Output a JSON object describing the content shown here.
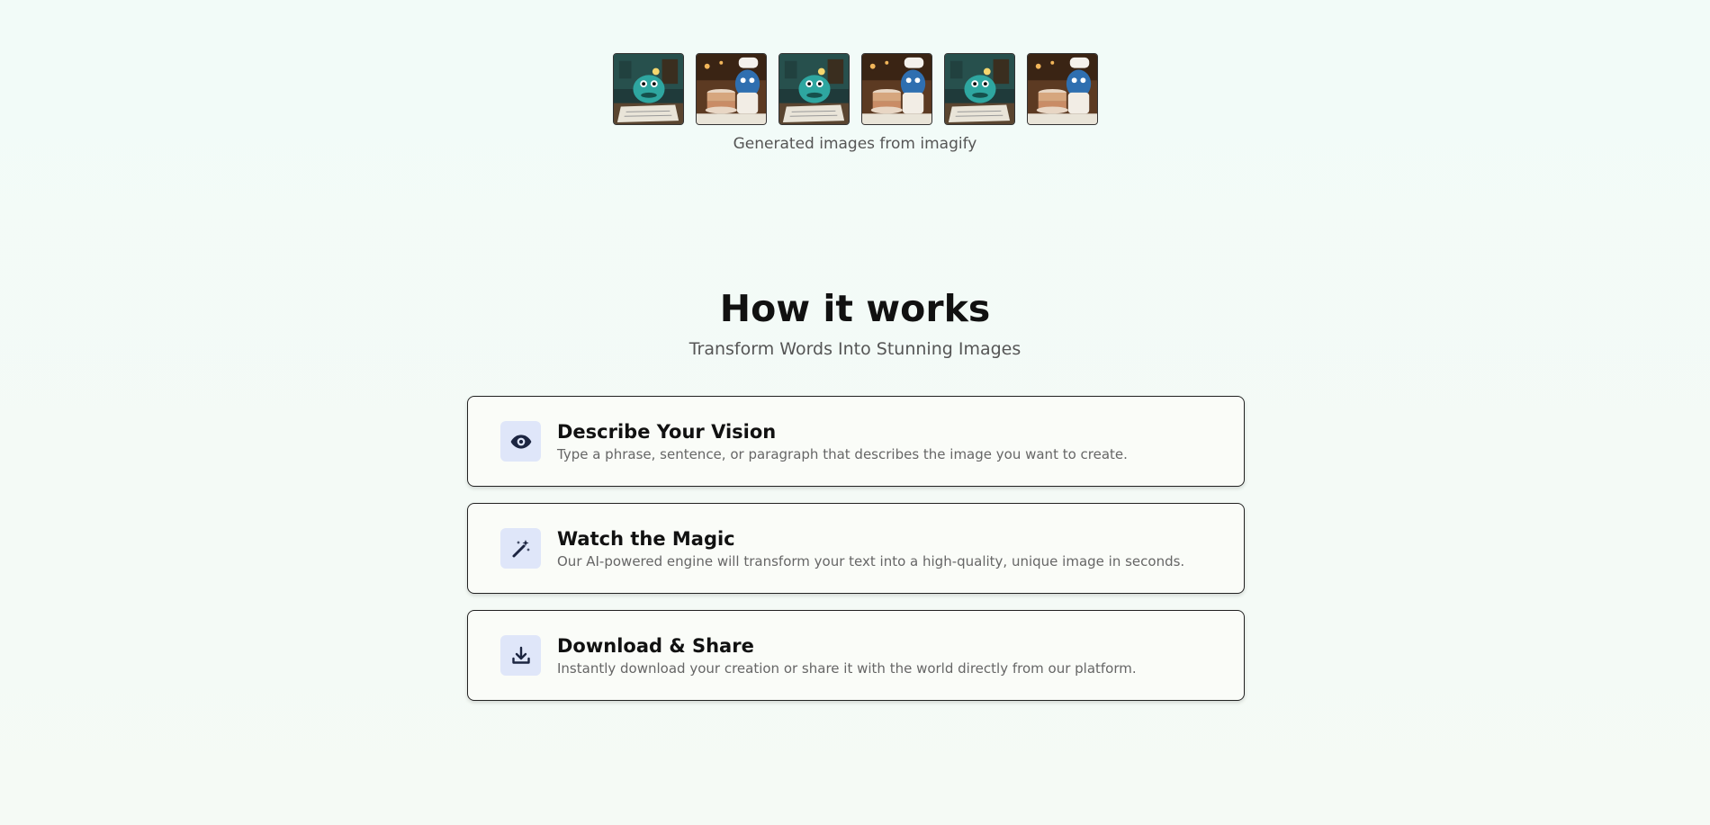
{
  "gallery": {
    "images": [
      {
        "alt": "monster-reading-thumbnail",
        "variant": "reading"
      },
      {
        "alt": "monster-chef-cake-thumbnail",
        "variant": "chef"
      },
      {
        "alt": "monster-reading-thumbnail",
        "variant": "reading"
      },
      {
        "alt": "monster-chef-cake-thumbnail",
        "variant": "chef"
      },
      {
        "alt": "monster-reading-thumbnail",
        "variant": "reading"
      },
      {
        "alt": "monster-chef-cake-thumbnail",
        "variant": "chef"
      }
    ],
    "caption": "Generated images from imagify"
  },
  "how_it_works": {
    "title": "How it works",
    "subtitle": "Transform Words Into Stunning Images",
    "steps": [
      {
        "icon": "eye-icon",
        "title": "Describe Your Vision",
        "description": "Type a phrase, sentence, or paragraph that describes the image you want to create."
      },
      {
        "icon": "magic-wand-icon",
        "title": "Watch the Magic",
        "description": "Our AI-powered engine will transform your text into a high-quality, unique image in seconds."
      },
      {
        "icon": "download-icon",
        "title": "Download & Share",
        "description": "Instantly download your creation or share it with the world directly from our platform."
      }
    ]
  },
  "colors": {
    "background": "#f2fbf8",
    "icon_tile": "#dfe6f9",
    "icon_color": "#1c2541",
    "text_primary": "#111111",
    "text_muted": "#666666"
  }
}
